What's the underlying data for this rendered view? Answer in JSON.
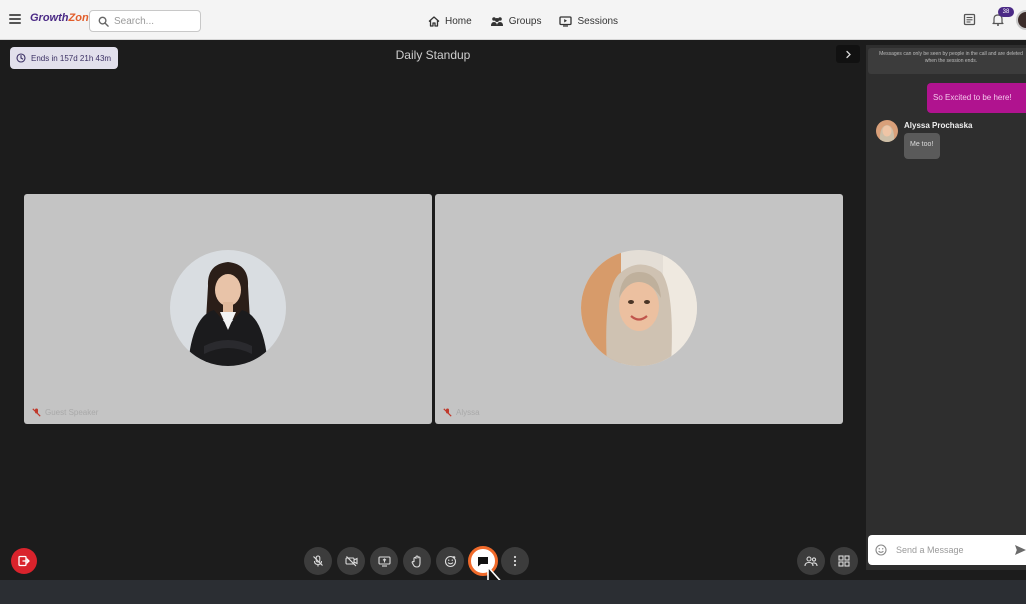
{
  "topbar": {
    "logo": {
      "part1": "Growth",
      "part2": "Zone"
    },
    "search": {
      "placeholder": "Search...",
      "value": ""
    },
    "nav": [
      {
        "label": "Home",
        "icon": "home-icon"
      },
      {
        "label": "Groups",
        "icon": "groups-icon"
      },
      {
        "label": "Sessions",
        "icon": "sessions-icon"
      }
    ],
    "notifications_badge": "38",
    "icons": [
      "menu-icon",
      "news-icon",
      "bell-icon",
      "avatar"
    ]
  },
  "meeting": {
    "ends_in": "Ends in 157d 21h 43m",
    "title": "Daily Standup"
  },
  "participants": [
    {
      "name": "Guest Speaker",
      "muted": true
    },
    {
      "name": "Alyssa",
      "muted": true
    }
  ],
  "controls": [
    {
      "id": "leave",
      "icon": "leave-icon"
    },
    {
      "id": "mic",
      "icon": "mic-off-icon"
    },
    {
      "id": "camera",
      "icon": "camera-off-icon"
    },
    {
      "id": "share",
      "icon": "screen-share-icon"
    },
    {
      "id": "raise-hand",
      "icon": "hand-icon"
    },
    {
      "id": "reactions",
      "icon": "emoji-icon"
    },
    {
      "id": "chat",
      "icon": "chat-icon",
      "active": true
    },
    {
      "id": "more",
      "icon": "more-icon"
    },
    {
      "id": "participants",
      "icon": "people-icon"
    },
    {
      "id": "layout",
      "icon": "grid-icon"
    }
  ],
  "chat": {
    "notice": "Messages can only be seen by people in the call and are deleted when the session ends.",
    "messages": [
      {
        "from": "me",
        "text": "So Excited to be here!"
      },
      {
        "from": "Alyssa Prochaska",
        "text": "Me too!"
      }
    ],
    "input_placeholder": "Send a Message"
  },
  "colors": {
    "accent": "#4b2a86",
    "brand_orange": "#e25d2a",
    "leave_red": "#d9232c",
    "chat_bubble_mine": "#b0138f",
    "active_ring": "#f06a2a"
  }
}
